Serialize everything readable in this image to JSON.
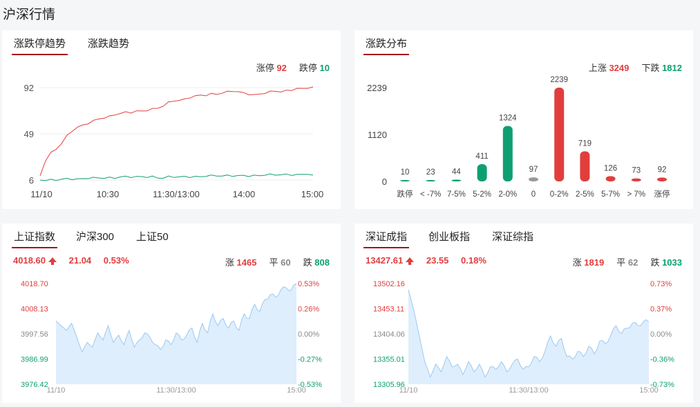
{
  "page": {
    "title": "沪深行情"
  },
  "trend_panel": {
    "tabs": [
      {
        "label": "涨跌停趋势"
      },
      {
        "label": "涨跌趋势"
      }
    ],
    "limit_up_label": "涨停",
    "limit_up_value": "92",
    "limit_down_label": "跌停",
    "limit_down_value": "10"
  },
  "dist_panel": {
    "tabs": [
      {
        "label": "涨跌分布"
      }
    ],
    "up_label": "上涨",
    "up_value": "3249",
    "down_label": "下跌",
    "down_value": "1812"
  },
  "sh_panel": {
    "tabs": [
      {
        "label": "上证指数"
      },
      {
        "label": "沪深300"
      },
      {
        "label": "上证50"
      }
    ],
    "price": "4018.60",
    "change": "21.04",
    "change_pct": "0.53%",
    "up_label": "涨",
    "up_count": "1465",
    "flat_label": "平",
    "flat_count": "60",
    "down_label": "跌",
    "down_count": "808"
  },
  "sz_panel": {
    "tabs": [
      {
        "label": "深证成指"
      },
      {
        "label": "创业板指"
      },
      {
        "label": "深证综指"
      }
    ],
    "price": "13427.61",
    "change": "23.55",
    "change_pct": "0.18%",
    "up_label": "涨",
    "up_count": "1819",
    "flat_label": "平",
    "flat_count": "62",
    "down_label": "跌",
    "down_count": "1033"
  },
  "colors": {
    "up": "#e23d3d",
    "down": "#0d9f73",
    "flat": "#999999",
    "accent": "#a3131b",
    "area_fill": "#deeefc",
    "area_line": "#9cc9f2"
  },
  "chart_data": [
    {
      "id": "limit-trend",
      "type": "line",
      "x_ticks": [
        "11/10",
        "10:30",
        "11:30/13:00",
        "14:00",
        "15:00"
      ],
      "y_ticks": [
        "92",
        "49",
        "6"
      ],
      "ylim": [
        6,
        92
      ],
      "series": [
        {
          "name": "涨停",
          "color": "#e23d3d",
          "values": [
            10,
            24,
            31,
            35,
            40,
            47,
            52,
            55,
            57,
            59,
            61,
            63,
            64,
            65,
            67,
            68,
            69,
            69,
            70,
            70,
            71,
            72,
            73,
            75,
            78,
            80,
            80,
            81,
            83,
            84,
            85,
            85,
            86,
            86,
            87,
            88,
            89,
            88,
            87,
            86,
            85,
            86,
            87,
            88,
            89,
            88,
            89,
            90,
            91,
            91,
            92,
            92
          ]
        },
        {
          "name": "跌停",
          "color": "#0d9f73",
          "values": [
            6,
            6,
            6,
            6,
            7,
            7,
            7,
            7,
            7,
            8,
            8,
            8,
            8,
            8,
            8,
            9,
            9,
            9,
            9,
            9,
            9,
            9,
            8,
            8,
            9,
            9,
            9,
            9,
            9,
            9,
            9,
            10,
            10,
            10,
            10,
            10,
            10,
            10,
            10,
            10,
            10,
            10,
            11,
            11,
            11,
            11,
            11,
            11,
            11,
            11,
            12,
            10
          ]
        }
      ]
    },
    {
      "id": "updown-distribution",
      "type": "bar",
      "categories": [
        "跌停",
        "< -7%",
        "7-5%",
        "5-2%",
        "2-0%",
        "0",
        "0-2%",
        "2-5%",
        "5-7%",
        "> 7%",
        "涨停"
      ],
      "values": [
        10,
        23,
        44,
        411,
        1324,
        97,
        2239,
        719,
        126,
        73,
        92
      ],
      "colors": [
        "#0d9f73",
        "#0d9f73",
        "#0d9f73",
        "#0d9f73",
        "#0d9f73",
        "#999999",
        "#e23d3d",
        "#e23d3d",
        "#e23d3d",
        "#e23d3d",
        "#e23d3d"
      ],
      "y_ticks": [
        "2239",
        "1120",
        "0"
      ],
      "ylim": [
        0,
        2239
      ]
    },
    {
      "id": "sh-index",
      "type": "area",
      "x_ticks": [
        "11/10",
        "11:30/13:00",
        "15:00"
      ],
      "y_ticks": [
        "4018.70",
        "4008.13",
        "3997.56",
        "3986.99",
        "3976.42"
      ],
      "y_right_ticks": [
        "0.53%",
        "0.26%",
        "0.00%",
        "-0.27%",
        "-0.53%"
      ],
      "ylim": [
        3976.42,
        4018.7
      ],
      "values": [
        4003,
        4001,
        3999,
        4002,
        3996,
        3990,
        3994,
        3992,
        3998,
        3995,
        4001,
        3994,
        3997,
        3993,
        3999,
        3992,
        3995,
        3998,
        3996,
        3993,
        3991,
        3995,
        3993,
        3998,
        3995,
        3997,
        4000,
        3994,
        4002,
        3998,
        4006,
        4001,
        4004,
        4000,
        4003,
        3999,
        4006,
        4004,
        4010,
        4007,
        4012,
        4014,
        4013,
        4016,
        4017,
        4016,
        4018.6
      ]
    },
    {
      "id": "sz-index",
      "type": "area",
      "x_ticks": [
        "11/10",
        "11:30/13:00",
        "15:00"
      ],
      "y_ticks": [
        "13502.16",
        "13453.11",
        "13404.06",
        "13355.01",
        "13305.96"
      ],
      "y_right_ticks": [
        "0.73%",
        "0.37%",
        "0.00%",
        "-0.36%",
        "-0.73%"
      ],
      "ylim": [
        13305.96,
        13502.16
      ],
      "values": [
        13490,
        13450,
        13400,
        13350,
        13320,
        13345,
        13330,
        13360,
        13340,
        13345,
        13325,
        13350,
        13330,
        13345,
        13320,
        13340,
        13335,
        13350,
        13330,
        13345,
        13355,
        13335,
        13340,
        13360,
        13350,
        13370,
        13400,
        13380,
        13395,
        13360,
        13355,
        13370,
        13360,
        13380,
        13365,
        13390,
        13385,
        13400,
        13420,
        13405,
        13415,
        13425,
        13420,
        13428,
        13427.61
      ]
    }
  ]
}
